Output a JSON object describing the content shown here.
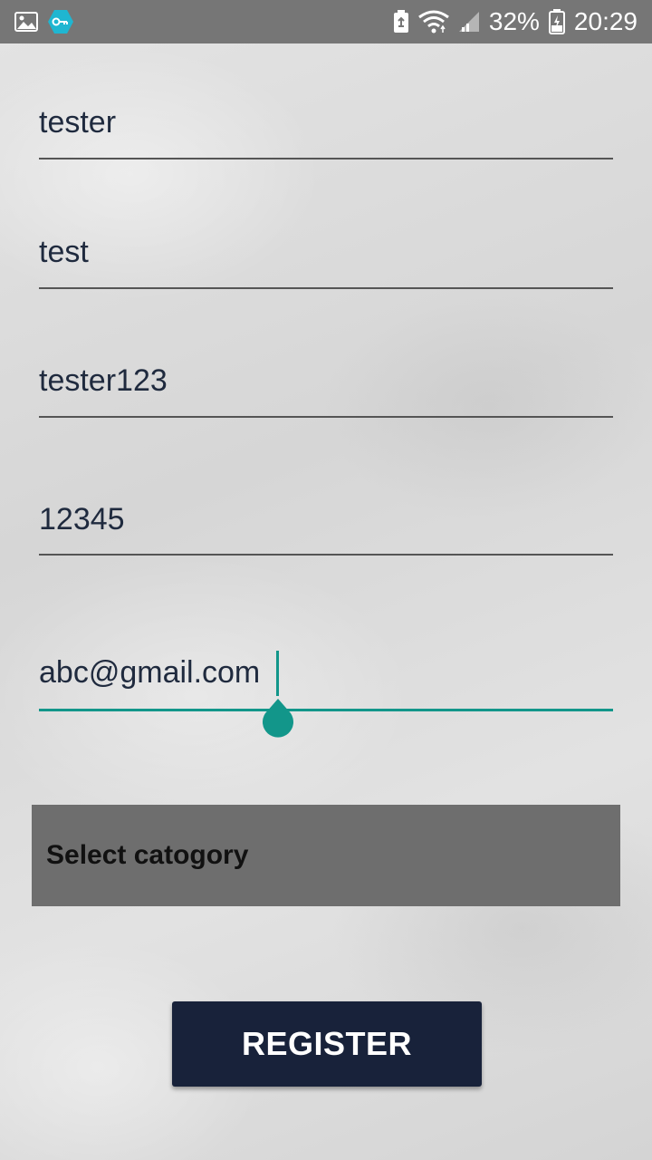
{
  "status_bar": {
    "left_icons": [
      "image-icon",
      "vpn-key-icon"
    ],
    "right_icons": [
      "battery-saver-icon",
      "wifi-icon",
      "signal-icon",
      "battery-icon"
    ],
    "battery_percent": "32%",
    "time": "20:29"
  },
  "form": {
    "fields": [
      {
        "value": "tester"
      },
      {
        "value": "test"
      },
      {
        "value": "tester123"
      },
      {
        "value": "12345"
      },
      {
        "value": "abc@gmail.com"
      }
    ],
    "category_spinner": {
      "selected": "Select catogory"
    },
    "register_button": {
      "label": "REGISTER"
    }
  },
  "colors": {
    "status_bar_bg": "#767676",
    "accent": "#12968a",
    "spinner_bg": "#6e6e6e",
    "button_bg": "#18223a",
    "field_text": "#1f2a3e"
  }
}
